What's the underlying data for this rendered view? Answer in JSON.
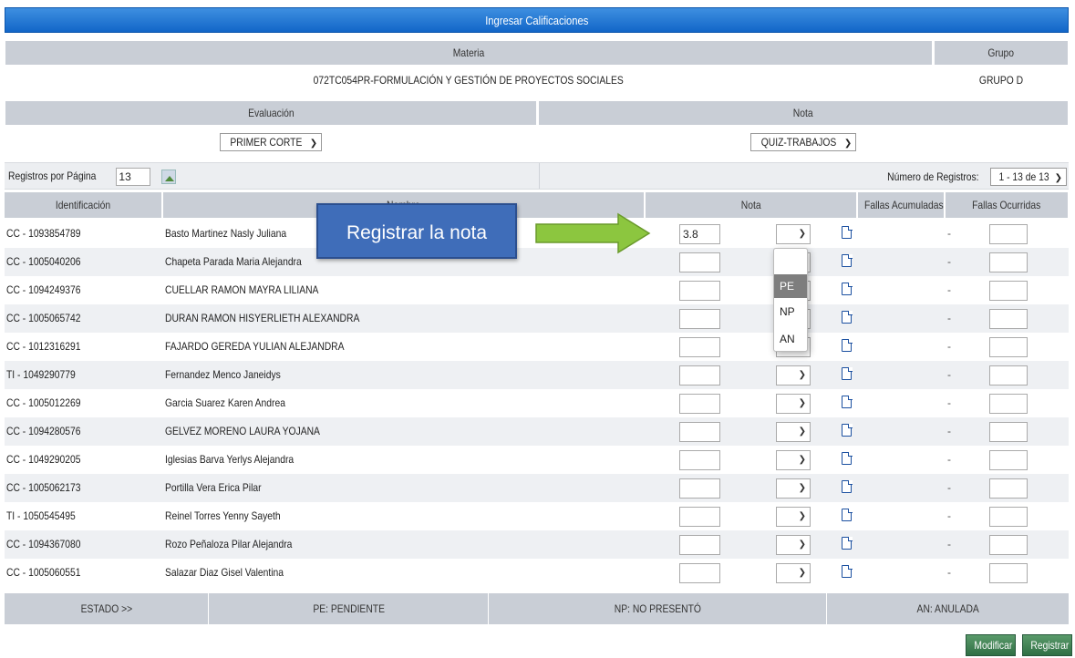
{
  "title": "Ingresar Calificaciones",
  "materia": {
    "header": "Materia",
    "value": "072TC054PR-FORMULACIÓN Y GESTIÓN DE PROYECTOS SOCIALES"
  },
  "grupo": {
    "header": "Grupo",
    "value": "GRUPO D"
  },
  "evaluacion": {
    "header": "Evaluación",
    "selected": "PRIMER CORTE"
  },
  "nota_tipo": {
    "header": "Nota",
    "selected": "QUIZ-TRABAJOS"
  },
  "registros": {
    "label": "Registros por Página",
    "value": "13",
    "count_label": "Número de Registros:",
    "count_selected": "1 - 13 de 13"
  },
  "columns": {
    "id": "Identificación",
    "name": "Nombre",
    "nota": "Nota",
    "fallas_acumuladas": "Fallas Acumuladas",
    "fallas_ocurridas": "Fallas Ocurridas"
  },
  "students": [
    {
      "id": "CC - 1093854789",
      "name": "Basto Martinez Nasly Juliana",
      "nota": "3.8",
      "fallas": "-"
    },
    {
      "id": "CC - 1005040206",
      "name": "Chapeta Parada Maria Alejandra",
      "nota": "",
      "fallas": "-"
    },
    {
      "id": "CC - 1094249376",
      "name": "CUELLAR RAMON MAYRA LILIANA",
      "nota": "",
      "fallas": "-"
    },
    {
      "id": "CC - 1005065742",
      "name": "DURAN RAMON HISYERLIETH ALEXANDRA",
      "nota": "",
      "fallas": "-"
    },
    {
      "id": "CC - 1012316291",
      "name": "FAJARDO GEREDA YULIAN ALEJANDRA",
      "nota": "",
      "fallas": "-"
    },
    {
      "id": "TI - 1049290779",
      "name": "Fernandez Menco Janeidys",
      "nota": "",
      "fallas": "-"
    },
    {
      "id": "CC - 1005012269",
      "name": "Garcia Suarez Karen Andrea",
      "nota": "",
      "fallas": "-"
    },
    {
      "id": "CC - 1094280576",
      "name": "GELVEZ MORENO LAURA YOJANA",
      "nota": "",
      "fallas": "-"
    },
    {
      "id": "CC - 1049290205",
      "name": "Iglesias Barva Yerlys Alejandra",
      "nota": "",
      "fallas": "-"
    },
    {
      "id": "CC - 1005062173",
      "name": "Portilla Vera Erica Pilar",
      "nota": "",
      "fallas": "-"
    },
    {
      "id": "TI - 1050545495",
      "name": "Reinel Torres Yenny Sayeth",
      "nota": "",
      "fallas": "-"
    },
    {
      "id": "CC - 1094367080",
      "name": "Rozo Peñaloza Pilar Alejandra",
      "nota": "",
      "fallas": "-"
    },
    {
      "id": "CC - 1005060551",
      "name": "Salazar Diaz Gisel Valentina",
      "nota": "",
      "fallas": "-"
    }
  ],
  "dropdown_options": [
    "",
    "PE",
    "NP",
    "AN"
  ],
  "callout": "Registrar la nota",
  "legend": {
    "estado": "ESTADO >>",
    "pe": "PE: PENDIENTE",
    "np": "NP: NO PRESENTÓ",
    "an": "AN: ANULADA"
  },
  "buttons": {
    "modificar": "Modificar",
    "registrar": "Registrar"
  },
  "colors": {
    "title_bar": "#1a6fd0",
    "header_gray": "#c9ced6",
    "callout": "#3f6db9",
    "arrow": "#8cc63f",
    "button": "#3d7d52"
  },
  "icons": {
    "doc": "document-icon",
    "chevron": "chevron-down-icon",
    "broken_image": "image-icon"
  }
}
